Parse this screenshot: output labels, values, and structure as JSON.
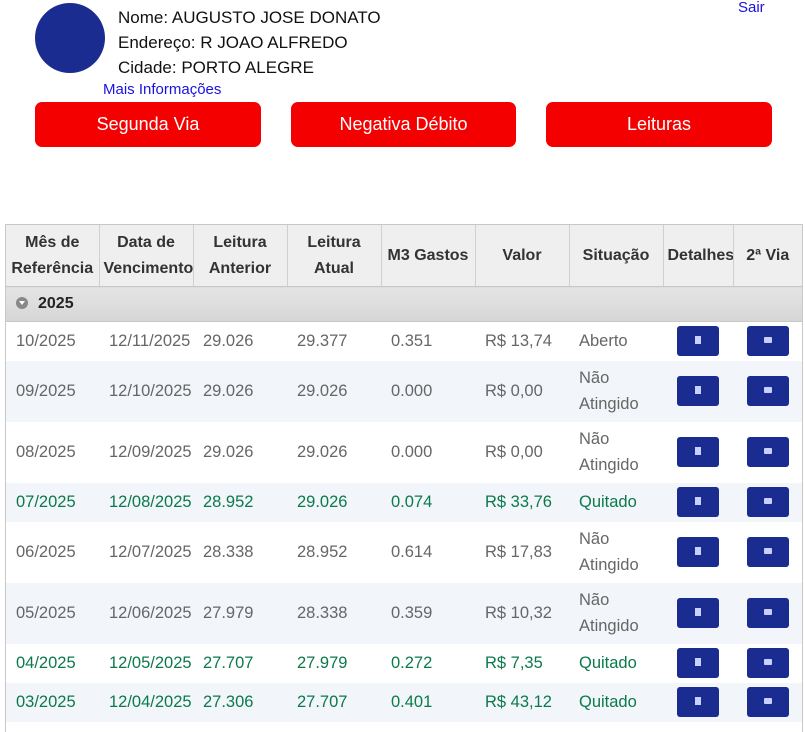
{
  "customer": {
    "name": "Nome: AUGUSTO JOSE DONATO",
    "address": "Endereço: R JOAO ALFREDO",
    "city": "Cidade: PORTO ALEGRE",
    "more_link": "Mais Informações"
  },
  "logout_label": "Sair",
  "actions": {
    "second_copy": "Segunda Via",
    "negative_debt": "Negativa Débito",
    "readings": "Leituras"
  },
  "table": {
    "headers": {
      "month": "Mês de Referência",
      "due": "Data de Vencimento",
      "prev": "Leitura Anterior",
      "curr": "Leitura Atual",
      "m3": "M3 Gastos",
      "value": "Valor",
      "status": "Situação",
      "details": "Detalhes",
      "copy": "2ª Via"
    },
    "group_label": "2025",
    "rows": [
      {
        "month": "10/2025",
        "due": "12/11/2025",
        "prev": "29.026",
        "curr": "29.377",
        "m3": "0.351",
        "value": "R$ 13,74",
        "status": "Aberto"
      },
      {
        "month": "09/2025",
        "due": "12/10/2025",
        "prev": "29.026",
        "curr": "29.026",
        "m3": "0.000",
        "value": "R$ 0,00",
        "status": "Não Atingido"
      },
      {
        "month": "08/2025",
        "due": "12/09/2025",
        "prev": "29.026",
        "curr": "29.026",
        "m3": "0.000",
        "value": "R$ 0,00",
        "status": "Não Atingido"
      },
      {
        "month": "07/2025",
        "due": "12/08/2025",
        "prev": "28.952",
        "curr": "29.026",
        "m3": "0.074",
        "value": "R$ 33,76",
        "status": "Quitado"
      },
      {
        "month": "06/2025",
        "due": "12/07/2025",
        "prev": "28.338",
        "curr": "28.952",
        "m3": "0.614",
        "value": "R$ 17,83",
        "status": "Não Atingido"
      },
      {
        "month": "05/2025",
        "due": "12/06/2025",
        "prev": "27.979",
        "curr": "28.338",
        "m3": "0.359",
        "value": "R$ 10,32",
        "status": "Não Atingido"
      },
      {
        "month": "04/2025",
        "due": "12/05/2025",
        "prev": "27.707",
        "curr": "27.979",
        "m3": "0.272",
        "value": "R$ 7,35",
        "status": "Quitado"
      },
      {
        "month": "03/2025",
        "due": "12/04/2025",
        "prev": "27.306",
        "curr": "27.707",
        "m3": "0.401",
        "value": "R$ 43,12",
        "status": "Quitado"
      }
    ]
  },
  "colors": {
    "accent_red": "#f50000",
    "avatar_blue": "#1a2c8f",
    "link_blue": "#1a12e0",
    "paid_green": "#0b7a4b"
  },
  "icons": {
    "details": "document-icon",
    "copy": "print-icon",
    "group_toggle": "collapse-caret-icon"
  }
}
